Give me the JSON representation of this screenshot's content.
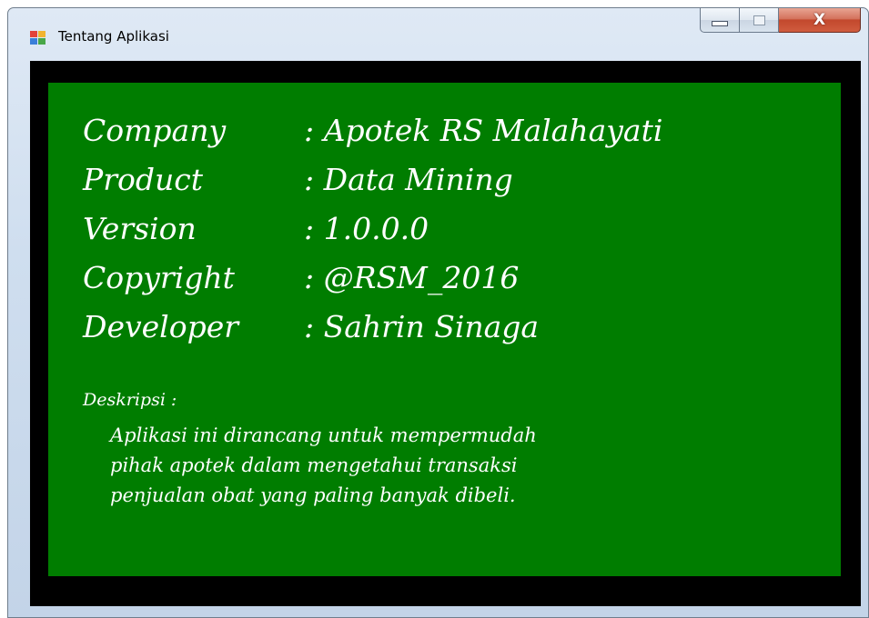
{
  "window": {
    "title": "Tentang Aplikasi",
    "icon": "app-window-icon",
    "controls": {
      "minimize_icon": "minimize-icon",
      "maximize_icon": "maximize-icon",
      "close_label": "X"
    }
  },
  "panel": {
    "background_color": "#007D00",
    "frame_color": "#000000",
    "rows": [
      {
        "label": "Company",
        "value": ": Apotek RS Malahayati"
      },
      {
        "label": "Product",
        "value": ": Data Mining"
      },
      {
        "label": "Version",
        "value": ": 1.0.0.0"
      },
      {
        "label": "Copyright",
        "value": ": @RSM_2016"
      },
      {
        "label": "Developer",
        "value": ": Sahrin Sinaga"
      }
    ],
    "description": {
      "heading": "Deskripsi :",
      "lines": [
        "Aplikasi ini dirancang untuk mempermudah",
        "pihak apotek dalam mengetahui transaksi",
        "penjualan obat yang paling banyak dibeli."
      ]
    }
  }
}
